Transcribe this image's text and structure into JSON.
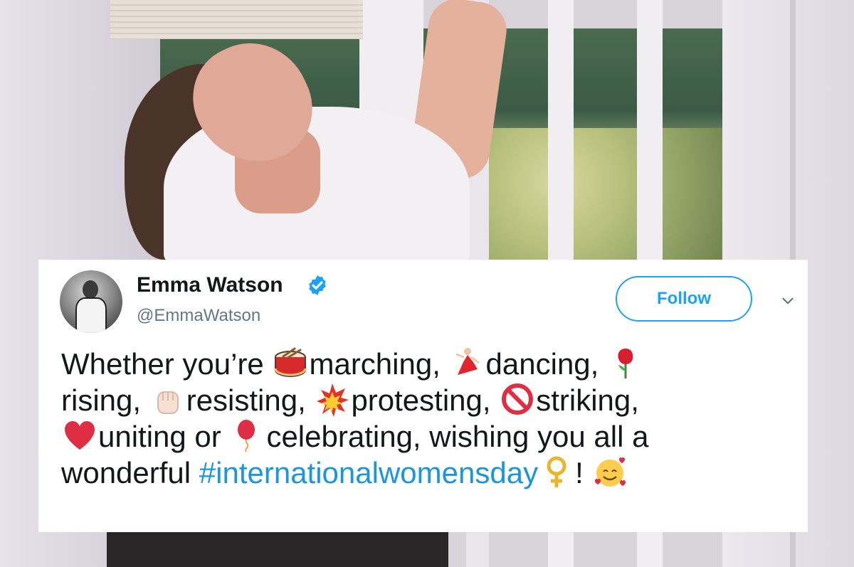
{
  "tweet": {
    "author_name": "Emma Watson",
    "author_handle": "@EmmaWatson",
    "follow_label": "Follow",
    "line1": [
      "Whether you’re ",
      "marching, ",
      "dancing, "
    ],
    "line2": [
      "rising, ",
      "resisting, ",
      "protesting, ",
      "striking,"
    ],
    "line3": [
      "uniting or ",
      "celebrating, wishing you all a"
    ],
    "line4_text": "wonderful ",
    "hashtag": "#internationalwomensday",
    "line4_end": "! ",
    "emojis": [
      "drum-emoji",
      "dancer-emoji",
      "rose-emoji",
      "raised-fist-emoji",
      "collision-emoji",
      "prohibited-emoji",
      "red-heart-emoji",
      "balloon-emoji",
      "female-sign-emoji",
      "smiling-face-with-hearts-emoji"
    ]
  },
  "colors": {
    "link_blue": "#1b95e0",
    "follow_blue": "#1da1f2",
    "text": "#14171a",
    "handle_gray": "#657786"
  }
}
